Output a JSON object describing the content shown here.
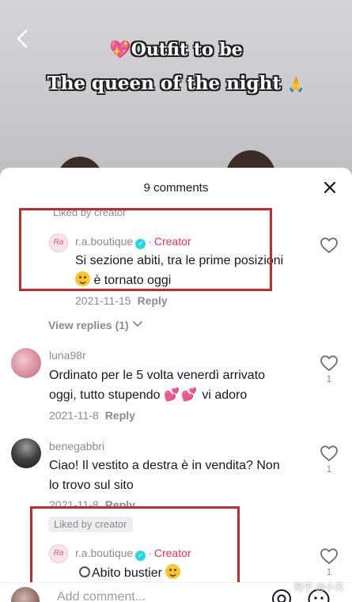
{
  "video": {
    "title_line1": "Outfit to be",
    "title_line2": "The queen of the night"
  },
  "comments_panel": {
    "title": "9 comments"
  },
  "comments": [
    {
      "liked_by_creator_label": "Liked by creator",
      "username": "r.a.boutique",
      "avatar_text": "Ra",
      "creator_label": "Creator",
      "text_line1": "Si sezione abiti, tra le prime posizioni",
      "text_line2": "è tornato oggi",
      "date": "2021-11-15",
      "reply_label": "Reply",
      "view_replies_label": "View replies (1)"
    },
    {
      "username": "luna98r",
      "text_line1": "Ordinato per le 5 volta venerdì arrivato",
      "text_line2_before": "oggi, tutto stupendo",
      "text_line2_after": "vi adoro",
      "date": "2021-11-8",
      "reply_label": "Reply",
      "like_count": "1"
    },
    {
      "username": "benegabbri",
      "text_line1": "Ciao! Il vestito a destra è in vendita? Non",
      "text_line2": "lo trovo sul sito",
      "date": "2021-11-8",
      "reply_label": "Reply",
      "like_count": "1"
    },
    {
      "liked_by_creator_label": "Liked by creator",
      "username": "r.a.boutique",
      "avatar_text": "Ra",
      "creator_label": "Creator",
      "text_line1": "Abito bustier",
      "like_count": "1"
    }
  ],
  "input": {
    "placeholder": "Add comment..."
  },
  "watermark": "知乎 @小天",
  "colors": {
    "accent_red": "#fe2c55",
    "verified": "#20d5ec",
    "highlight_box": "#c8282b"
  }
}
